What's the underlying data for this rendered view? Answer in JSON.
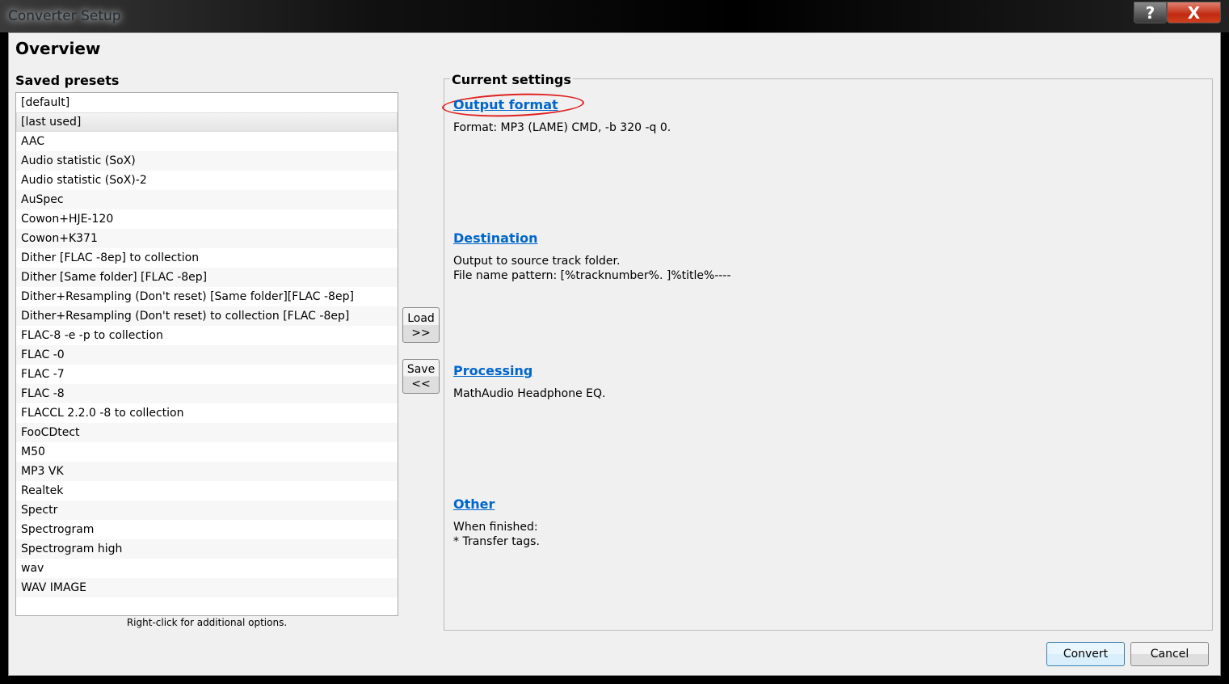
{
  "window": {
    "title": "Converter Setup",
    "help_label": "?",
    "close_label": "X"
  },
  "overview": {
    "title": "Overview"
  },
  "presets": {
    "title": "Saved presets",
    "hint": "Right-click for additional options.",
    "selected_index": 1,
    "items": [
      "[default]",
      "[last used]",
      "AAC",
      "Audio statistic (SoX)",
      "Audio statistic (SoX)-2",
      "AuSpec",
      "Cowon+HJE-120",
      "Cowon+K371",
      "Dither [FLAC -8ep] to collection",
      "Dither [Same folder] [FLAC -8ep]",
      "Dither+Resampling (Don't reset) [Same folder][FLAC -8ep]",
      "Dither+Resampling (Don't reset) to collection [FLAC -8ep]",
      "FLAC-8 -e -p  to collection",
      "FLAC -0",
      "FLAC -7",
      "FLAC -8",
      "FLACCL 2.2.0 -8 to collection",
      "FooCDtect",
      "M50",
      "MP3 VK",
      "Realtek",
      "Spectr",
      "Spectrogram",
      "Spectrogram high",
      "wav",
      "WAV IMAGE"
    ]
  },
  "buttons": {
    "load_top": "Load",
    "load_bottom": ">>",
    "save_top": "Save",
    "save_bottom": "<<",
    "convert": "Convert",
    "cancel": "Cancel"
  },
  "settings": {
    "title": "Current settings",
    "output_format": {
      "link": "Output format",
      "lines": [
        "Format: MP3 (LAME) CMD, -b 320 -q 0."
      ]
    },
    "destination": {
      "link": "Destination",
      "lines": [
        "Output to source track folder.",
        "File name pattern: [%tracknumber%. ]%title%----"
      ]
    },
    "processing": {
      "link": "Processing",
      "lines": [
        "MathAudio Headphone EQ."
      ]
    },
    "other": {
      "link": "Other",
      "lines": [
        "When finished:",
        "* Transfer tags."
      ]
    }
  }
}
